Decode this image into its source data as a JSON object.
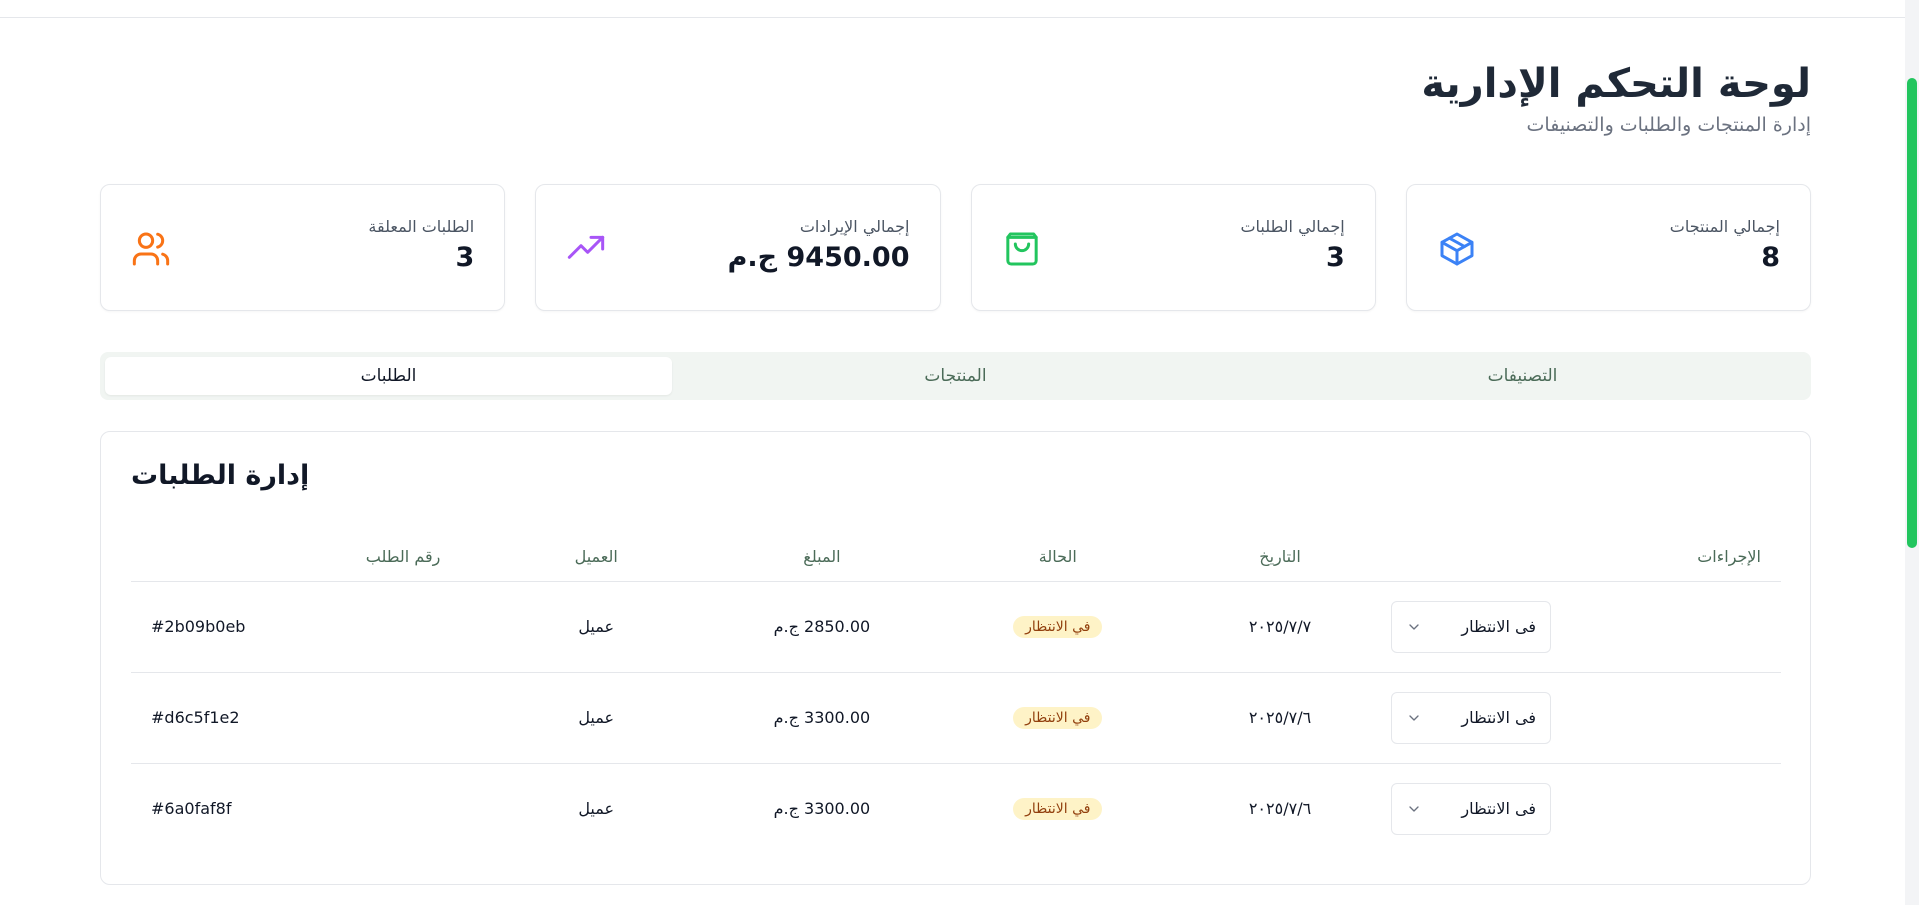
{
  "header": {
    "title": "لوحة التحكم الإدارية",
    "subtitle": "إدارة المنتجات والطلبات والتصنيفات"
  },
  "stats": [
    {
      "label": "إجمالي المنتجات",
      "value": "8",
      "icon": "package-icon",
      "color": "#3b82f6"
    },
    {
      "label": "إجمالي الطلبات",
      "value": "3",
      "icon": "shopping-bag-icon",
      "color": "#22c55e"
    },
    {
      "label": "إجمالي الإيرادات",
      "value": "9450.00 ج.م",
      "icon": "trending-up-icon",
      "color": "#a855f7"
    },
    {
      "label": "الطلبات المعلقة",
      "value": "3",
      "icon": "users-icon",
      "color": "#f97316"
    }
  ],
  "tabs": [
    {
      "label": "التصنيفات",
      "active": false
    },
    {
      "label": "المنتجات",
      "active": false
    },
    {
      "label": "الطلبات",
      "active": true
    }
  ],
  "orders": {
    "title": "إدارة الطلبات",
    "columns": {
      "actions": "الإجراءات",
      "date": "التاريخ",
      "status": "الحالة",
      "amount": "المبلغ",
      "customer": "العميل",
      "order_id": "رقم الطلب"
    },
    "rows": [
      {
        "select_value": "فى الانتظار",
        "date": "٢٠٢٥/٧/٧",
        "status": "في الانتظار",
        "amount": "2850.00 ج.م",
        "customer": "عميل",
        "order_id": "#2b09b0eb"
      },
      {
        "select_value": "فى الانتظار",
        "date": "٢٠٢٥/٧/٦",
        "status": "في الانتظار",
        "amount": "3300.00 ج.م",
        "customer": "عميل",
        "order_id": "#d6c5f1e2"
      },
      {
        "select_value": "فى الانتظار",
        "date": "٢٠٢٥/٧/٦",
        "status": "في الانتظار",
        "amount": "3300.00 ج.م",
        "customer": "عميل",
        "order_id": "#6a0faf8f"
      }
    ]
  },
  "colors": {
    "accent": "#22c55e",
    "pending_badge_bg": "#fef3c7",
    "pending_badge_text": "#92400e"
  }
}
